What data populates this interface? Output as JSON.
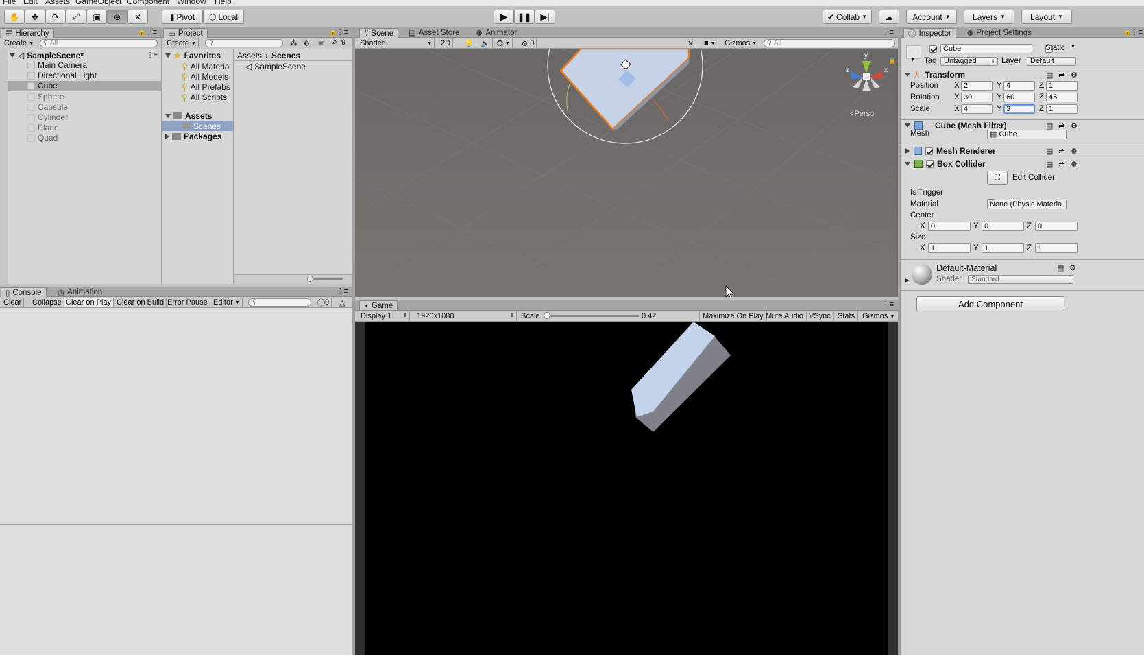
{
  "menu": [
    "File",
    "Edit",
    "Assets",
    "GameObject",
    "Component",
    "Window",
    "Help"
  ],
  "toolbar": {
    "pivot": "Pivot",
    "local": "Local",
    "collab": "Collab",
    "account": "Account",
    "layers": "Layers",
    "layout": "Layout"
  },
  "hierarchy": {
    "tab": "Hierarchy",
    "create": "Create",
    "search_placeholder": "All",
    "scene": "SampleScene*",
    "items": [
      {
        "label": "Main Camera",
        "dim": false
      },
      {
        "label": "Directional Light",
        "dim": false
      },
      {
        "label": "Cube",
        "dim": false,
        "selected": true
      },
      {
        "label": "Sphere",
        "dim": true
      },
      {
        "label": "Capsule",
        "dim": true
      },
      {
        "label": "Cylinder",
        "dim": true
      },
      {
        "label": "Plane",
        "dim": true
      },
      {
        "label": "Quad",
        "dim": true
      }
    ]
  },
  "project": {
    "tab": "Project",
    "create": "Create",
    "hidden_count": "9",
    "favorites_label": "Favorites",
    "favorites": [
      "All Materia",
      "All Models",
      "All Prefabs",
      "All Scripts"
    ],
    "assets_label": "Assets",
    "assets_children": [
      "Scenes"
    ],
    "packages_label": "Packages",
    "breadcrumb": [
      "Assets",
      "Scenes"
    ],
    "files": [
      "SampleScene"
    ]
  },
  "scene": {
    "tabs": [
      "Scene",
      "Asset Store",
      "Animator"
    ],
    "shading": "Shaded",
    "mode2d": "2D",
    "fx_count": "0",
    "gizmos": "Gizmos",
    "search_placeholder": "All",
    "persp": "Persp",
    "axes": {
      "y": "y",
      "z": "z",
      "x": "x"
    }
  },
  "console": {
    "tabs": [
      "Console",
      "Animation"
    ],
    "buttons": [
      "Clear",
      "Collapse",
      "Clear on Play",
      "Clear on Build",
      "Error Pause",
      "Editor"
    ],
    "error_count": "0"
  },
  "game": {
    "tab": "Game",
    "display": "Display 1",
    "resolution": "1920x1080",
    "scale_label": "Scale",
    "scale_value": "0.42",
    "scale_fraction": 0.03,
    "buttons": [
      "Maximize On Play",
      "Mute Audio",
      "VSync",
      "Stats",
      "Gizmos"
    ]
  },
  "inspector": {
    "tabs": [
      "Inspector",
      "Project Settings"
    ],
    "object_name": "Cube",
    "static_label": "Static",
    "tag_label": "Tag",
    "tag_value": "Untagged",
    "layer_label": "Layer",
    "layer_value": "Default",
    "transform": {
      "title": "Transform",
      "position": {
        "label": "Position",
        "x": "2",
        "y": "4",
        "z": "1"
      },
      "rotation": {
        "label": "Rotation",
        "x": "30",
        "y": "60",
        "z": "45"
      },
      "scale": {
        "label": "Scale",
        "x": "4",
        "y": "3",
        "z": "1"
      }
    },
    "mesh_filter": {
      "title": "Cube (Mesh Filter)",
      "mesh_label": "Mesh",
      "mesh_value": "Cube"
    },
    "mesh_renderer": {
      "title": "Mesh Renderer"
    },
    "box_collider": {
      "title": "Box Collider",
      "edit_label": "Edit Collider",
      "is_trigger_label": "Is Trigger",
      "material_label": "Material",
      "material_value": "None (Physic Materia",
      "center_label": "Center",
      "center": {
        "x": "0",
        "y": "0",
        "z": "0"
      },
      "size_label": "Size",
      "size": {
        "x": "1",
        "y": "1",
        "z": "1"
      }
    },
    "material": {
      "name": "Default-Material",
      "shader_label": "Shader",
      "shader_value": "Standard"
    },
    "add_component": "Add Component",
    "axis_labels": {
      "x": "X",
      "y": "Y",
      "z": "Z"
    }
  },
  "colors": {
    "selection_outline": "#f07a1e",
    "scene_bg": "#72706d",
    "game_bg": "#000000",
    "cube_light": "#c3d3ec",
    "cube_dark": "#7f8389"
  }
}
